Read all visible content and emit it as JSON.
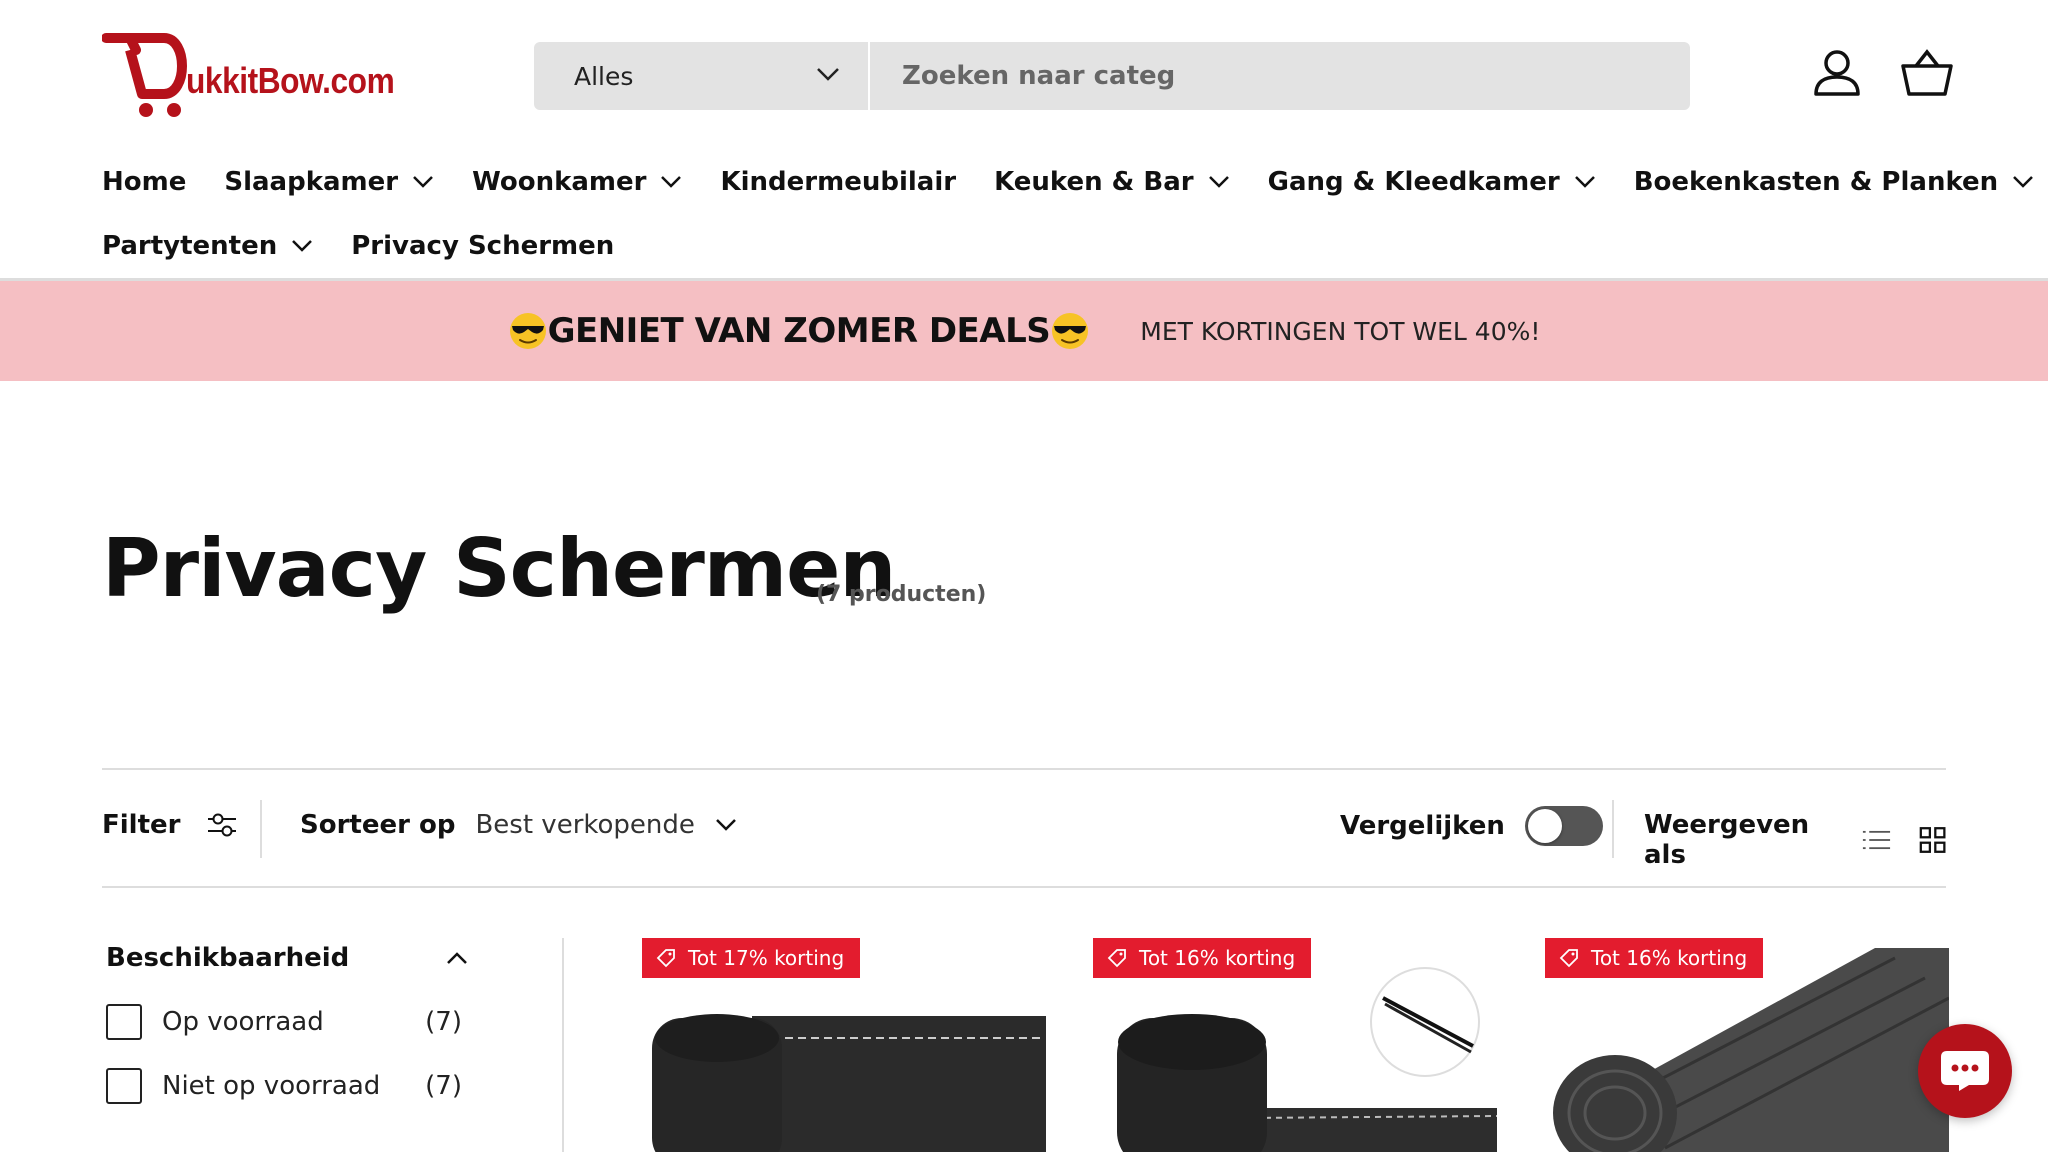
{
  "brand": {
    "logo_text": "ukkitBow.com",
    "color": "#b5121b"
  },
  "search": {
    "category": "Alles",
    "placeholder": "Zoeken naar categ"
  },
  "header_icons": [
    "account-icon",
    "basket-icon"
  ],
  "nav": {
    "row1": [
      {
        "label": "Home",
        "dropdown": false
      },
      {
        "label": "Slaapkamer",
        "dropdown": true
      },
      {
        "label": "Woonkamer",
        "dropdown": true
      },
      {
        "label": "Kindermeubilair",
        "dropdown": false
      },
      {
        "label": "Keuken & Bar",
        "dropdown": true
      },
      {
        "label": "Gang & Kleedkamer",
        "dropdown": true
      },
      {
        "label": "Boekenkasten & Planken",
        "dropdown": true
      }
    ],
    "row2": [
      {
        "label": "Partytenten",
        "dropdown": true
      },
      {
        "label": "Privacy Schermen",
        "dropdown": false,
        "active": true
      }
    ]
  },
  "banner": {
    "main": "GENIET VAN ZOMER DEALS",
    "sub": "MET KORTINGEN TOT WEL 40%!",
    "background": "#f5bfc3"
  },
  "page": {
    "title": "Privacy Schermen",
    "count": "(7 producten)"
  },
  "toolbar": {
    "filter_label": "Filter",
    "sort_label": "Sorteer op",
    "sort_value": "Best verkopende",
    "compare_label": "Vergelijken",
    "view_label": "Weergeven als"
  },
  "sidebar": {
    "heading": "Beschikbaarheid",
    "options": [
      {
        "label": "Op voorraad",
        "count": "(7)"
      },
      {
        "label": "Niet op voorraad",
        "count": "(7)"
      }
    ]
  },
  "products": [
    {
      "badge": "Tot 17% korting"
    },
    {
      "badge": "Tot 16% korting"
    },
    {
      "badge": "Tot 16% korting"
    }
  ],
  "colors": {
    "badge": "#e31c2e",
    "chat": "#b5121b",
    "toggle": "#555555"
  }
}
